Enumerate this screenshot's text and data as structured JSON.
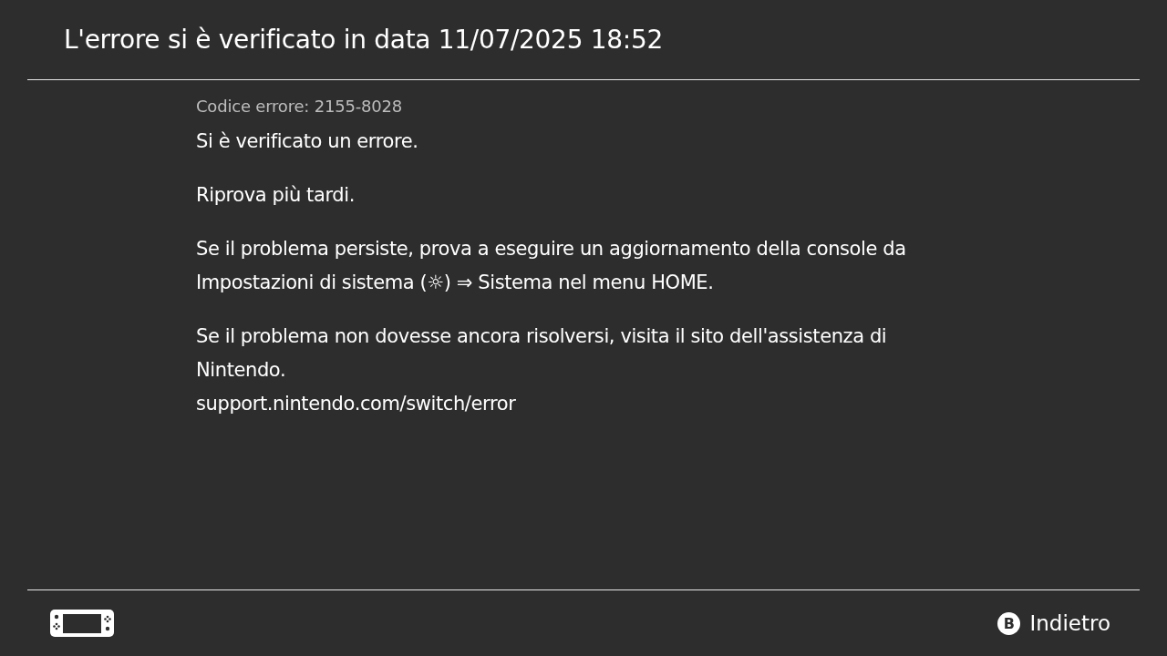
{
  "header": {
    "title": "L'errore si è verificato in data 11/07/2025 18:52"
  },
  "error_code": "Codice errore: 2155-8028",
  "paragraphs": [
    {
      "lines": [
        "Si è verificato un errore."
      ]
    },
    {
      "lines": [
        "Riprova più tardi."
      ]
    },
    {
      "lines": [
        "Se il problema persiste, prova a eseguire un aggiornamento della console da Impostazioni di sistema (☼) ⇒ Sistema nel menu HOME."
      ]
    },
    {
      "lines": [
        "Se il problema non dovesse ancora risolversi, visita il sito dell'assistenza di Nintendo.",
        "support.nintendo.com/switch/error"
      ]
    }
  ],
  "footer": {
    "back_button": {
      "glyph": "B",
      "label": "Indietro"
    }
  }
}
